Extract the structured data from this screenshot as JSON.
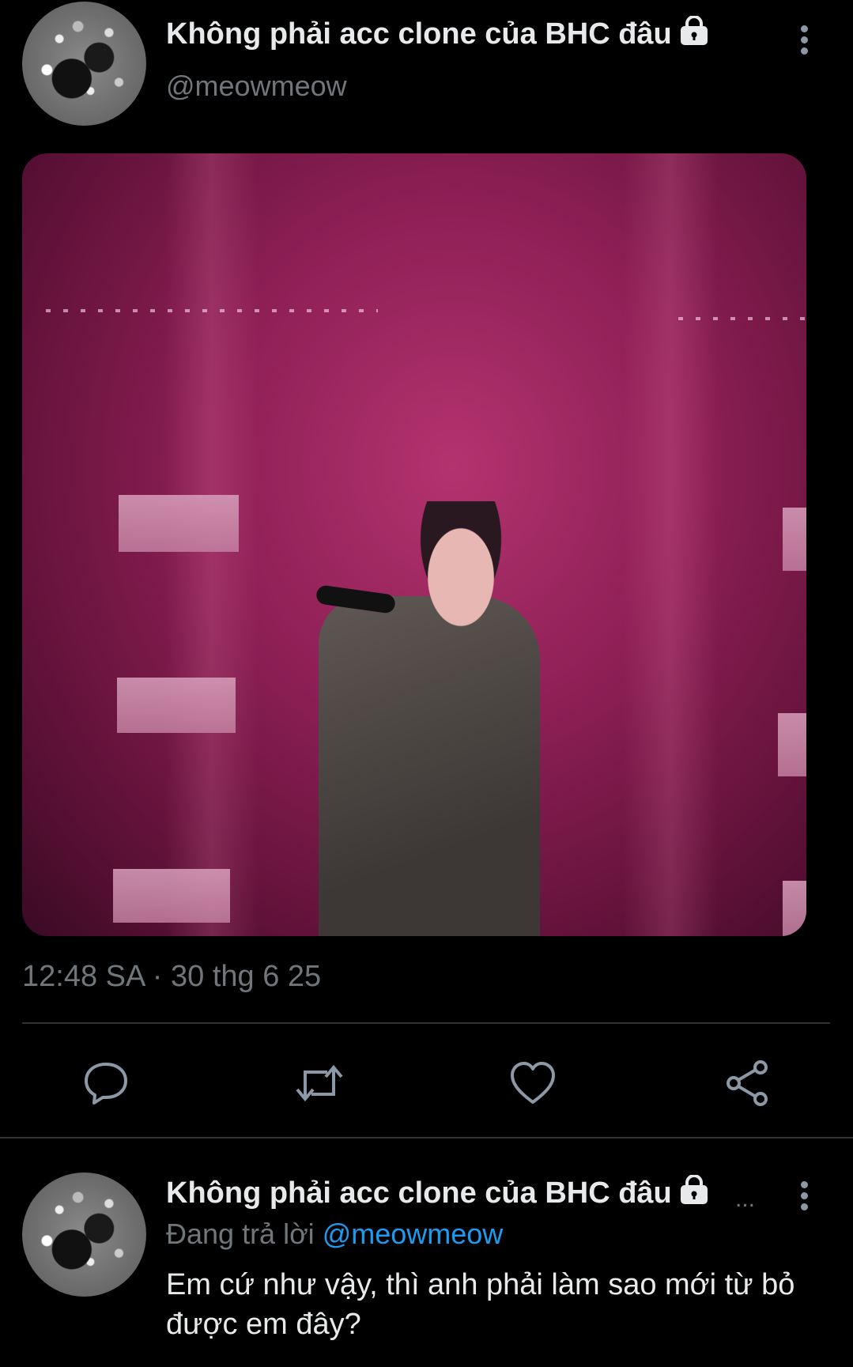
{
  "tweet": {
    "display_name": "Không phải acc clone của BHC đâu",
    "handle": "@meowmeow",
    "timestamp": "12:48 SA · 30 thg 6 25",
    "media_alt": "singer-performing-on-stage-photo"
  },
  "actions": [
    {
      "name": "reply",
      "icon": "speech-bubble-icon"
    },
    {
      "name": "retweet",
      "icon": "retweet-icon"
    },
    {
      "name": "like",
      "icon": "heart-icon"
    },
    {
      "name": "share",
      "icon": "share-icon"
    }
  ],
  "reply": {
    "display_name": "Không phải acc clone của BHC đâu",
    "ellipsis": "...",
    "replying_label": "Đang trả lời",
    "replying_to": "@meowmeow",
    "text": "Em cứ như vậy, thì anh phải làm sao mới từ bỏ được em đây?"
  },
  "colors": {
    "background": "#000000",
    "text": "#e7e9ea",
    "muted": "#71767b",
    "mention": "#1d9bf0",
    "divider": "#2f3336"
  }
}
